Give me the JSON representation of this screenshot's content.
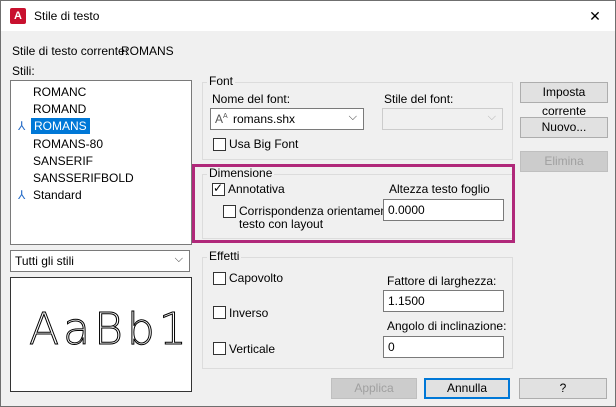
{
  "window": {
    "title": "Stile di testo",
    "app_icon_letter": "A",
    "close_glyph": "✕"
  },
  "current_style": {
    "label": "Stile di testo corrente:",
    "value": "ROMANS"
  },
  "styles_label": "Stili:",
  "styles": [
    {
      "name": "ROMANC",
      "annotative": false,
      "selected": false
    },
    {
      "name": "ROMAND",
      "annotative": false,
      "selected": false
    },
    {
      "name": "ROMANS",
      "annotative": true,
      "selected": true
    },
    {
      "name": "ROMANS-80",
      "annotative": false,
      "selected": false
    },
    {
      "name": "SANSERIF",
      "annotative": false,
      "selected": false
    },
    {
      "name": "SANSSERIFBOLD",
      "annotative": false,
      "selected": false
    },
    {
      "name": "Standard",
      "annotative": true,
      "selected": false
    }
  ],
  "annotative_icon": "annotative-icon",
  "filter": {
    "value": "Tutti gli stili"
  },
  "preview": {
    "text": "AaBb1"
  },
  "font": {
    "group_label": "Font",
    "name_label": "Nome del font:",
    "name_value": "romans.shx",
    "style_label": "Stile del font:",
    "style_value": "",
    "big_font_label": "Usa Big Font",
    "big_font_checked": false
  },
  "dimension": {
    "group_label": "Dimensione",
    "annotative_label": "Annotativa",
    "annotative_checked": true,
    "orientation_label_1": "Corrispondenza orientamento",
    "orientation_label_2": "testo con layout",
    "orientation_checked": false,
    "paper_height_label": "Altezza testo foglio",
    "paper_height_value": "0.0000"
  },
  "effects": {
    "group_label": "Effetti",
    "upside_down_label": "Capovolto",
    "backwards_label": "Inverso",
    "vertical_label": "Verticale",
    "width_factor_label": "Fattore di larghezza:",
    "width_factor_value": "1.1500",
    "oblique_label": "Angolo di inclinazione:",
    "oblique_value": "0"
  },
  "buttons": {
    "set_current": "Imposta corrente",
    "new": "Nuovo...",
    "delete": "Elimina",
    "apply": "Applica",
    "cancel": "Annulla",
    "help": "?"
  },
  "colors": {
    "highlight": "#b0287a",
    "selection": "#0078d7",
    "app_icon": "#c8102e"
  }
}
